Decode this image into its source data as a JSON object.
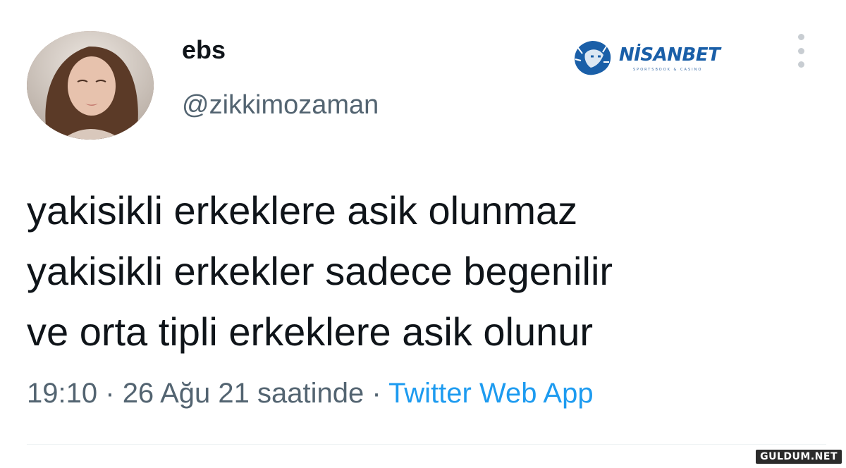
{
  "user": {
    "display_name": "ebs",
    "handle": "@zikkimozaman",
    "avatar": "profile-photo"
  },
  "brand": {
    "name": "NİSANBET",
    "tagline": "SPORTSBOOK & CASINO",
    "color": "#1a5fa8"
  },
  "tweet": {
    "lines": [
      "yakisikli erkeklere asik olunmaz",
      "yakisikli erkekler sadece begenilir",
      "ve orta tipli erkeklere asik olunur"
    ]
  },
  "meta": {
    "time": "19:10",
    "date": "26 Ağu 21 saatinde",
    "separator": "·",
    "source": "Twitter Web App"
  },
  "watermark": "GULDUM.NET",
  "colors": {
    "text": "#0f1419",
    "secondary": "#536471",
    "link": "#1d9bf0"
  }
}
